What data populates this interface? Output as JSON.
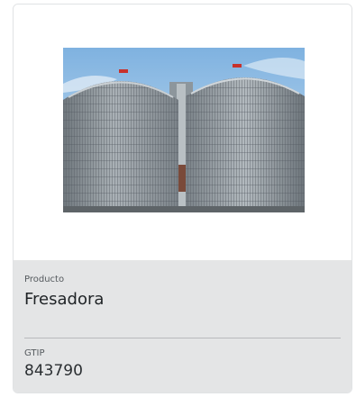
{
  "card": {
    "image_alt": "Silos",
    "product_label": "Producto",
    "product_value": "Fresadora",
    "gtip_label": "GTIP",
    "gtip_value": "843790"
  },
  "colors": {
    "info_background": "#e4e5e6",
    "card_border": "#e0e2e4",
    "sky": "#9fc6e8",
    "silo_metal": "#8f969c",
    "silo_cap_red": "#c8312b"
  }
}
